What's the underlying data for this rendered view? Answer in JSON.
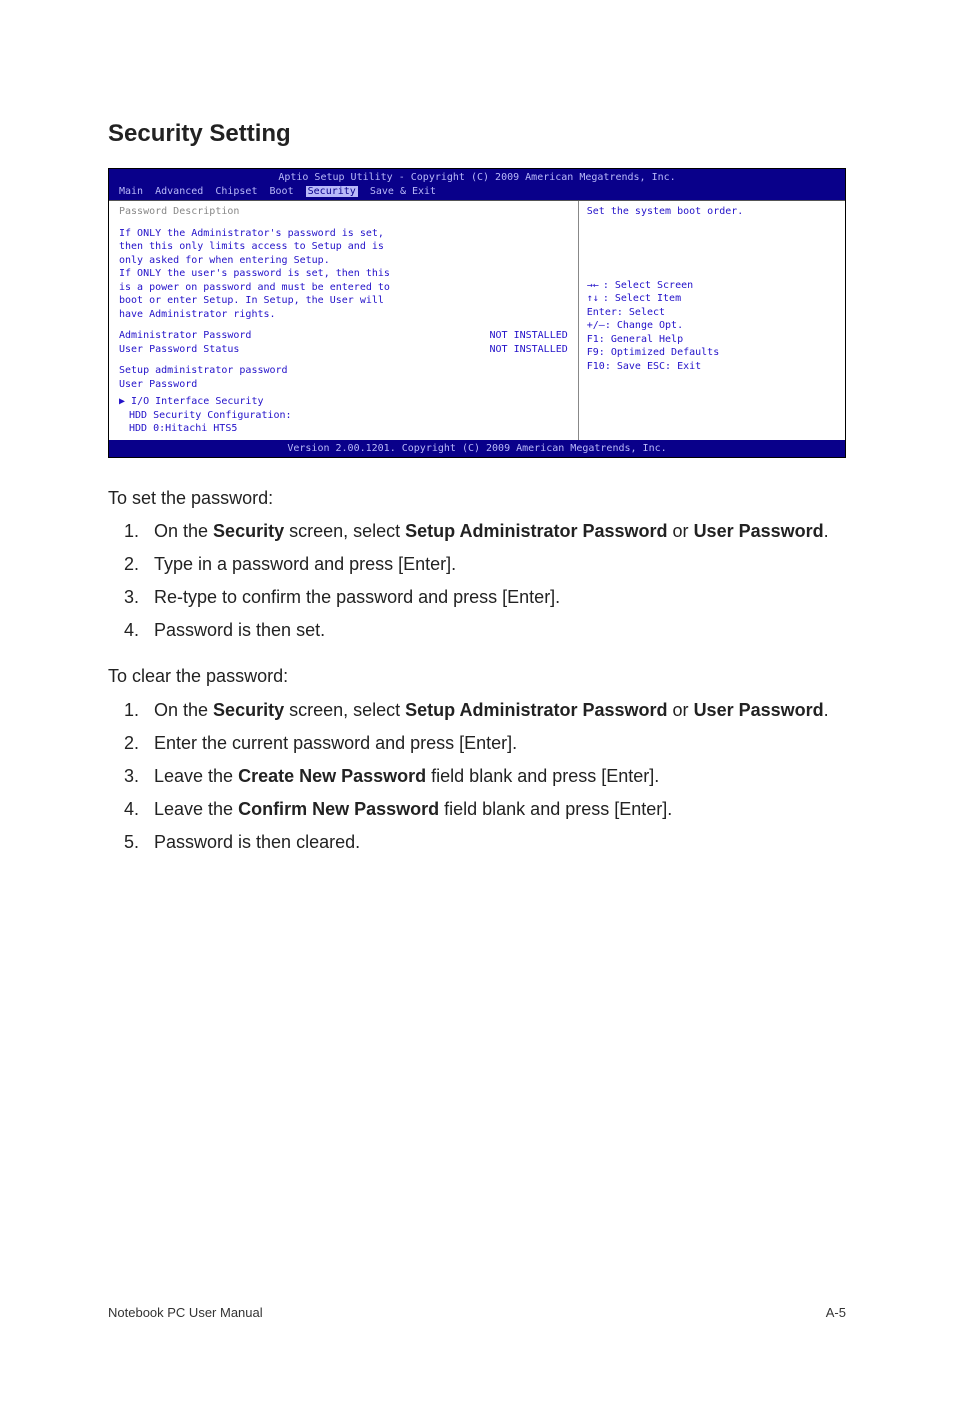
{
  "heading": "Security Setting",
  "bios": {
    "title": "Aptio Setup Utility - Copyright (C) 2009 American Megatrends, Inc.",
    "tabs": {
      "t0": "Main",
      "t1": "Advanced",
      "t2": "Chipset",
      "t3": "Boot",
      "t4": "Security",
      "t5": "Save & Exit"
    },
    "left_head": "Password Description",
    "desc0": "If ONLY the Administrator's password is set,",
    "desc1": "then this only limits access to Setup and is",
    "desc2": "only asked for when entering Setup.",
    "desc3": "If ONLY the user's password is set, then this",
    "desc4": "is a power on password and must be entered to",
    "desc5": "boot or enter Setup. In Setup, the User will",
    "desc6": "have Administrator rights.",
    "row0l": "Administrator Password",
    "row0r": "NOT INSTALLED",
    "row1l": "User Password Status",
    "row1r": "NOT INSTALLED",
    "row2": "Setup administrator password",
    "row3": "User Password",
    "row4": "I/O Interface Security",
    "row5": "HDD Security Configuration:",
    "row6": "HDD 0:Hitachi HTS5",
    "right_head": "Set the system boot order.",
    "h0": "Select Screen",
    "h1": "Select Item",
    "h2": "Enter: Select",
    "h3": "+/—:  Change Opt.",
    "h4": "F1:    General Help",
    "h5": "F9:    Optimized Defaults",
    "h6": "F10:  Save    ESC:  Exit",
    "footer": "Version 2.00.1201. Copyright (C) 2009 American Megatrends, Inc."
  },
  "set_intro": "To set the password:",
  "set_steps": {
    "s1a": "On the ",
    "s1b": "Security",
    "s1c": " screen, select ",
    "s1d": "Setup Administrator Password",
    "s1e": " or ",
    "s1f": "User Password",
    "s1g": ".",
    "s2": "Type in a password and press [Enter].",
    "s3": "Re-type to confirm the password and press [Enter].",
    "s4": "Password is then set."
  },
  "clear_intro": "To clear the password:",
  "clear_steps": {
    "c1a": "On the ",
    "c1b": "Security",
    "c1c": " screen, select ",
    "c1d": "Setup Administrator Password",
    "c1e": " or ",
    "c1f": "User Password",
    "c1g": ".",
    "c2": "Enter the current password and press [Enter].",
    "c3a": "Leave the ",
    "c3b": "Create New Password",
    "c3c": " field blank and press [Enter].",
    "c4a": "Leave the ",
    "c4b": "Confirm New Password",
    "c4c": " field blank and press [Enter].",
    "c5": "Password is then cleared."
  },
  "footer_left": "Notebook PC User Manual",
  "footer_right": "A-5"
}
